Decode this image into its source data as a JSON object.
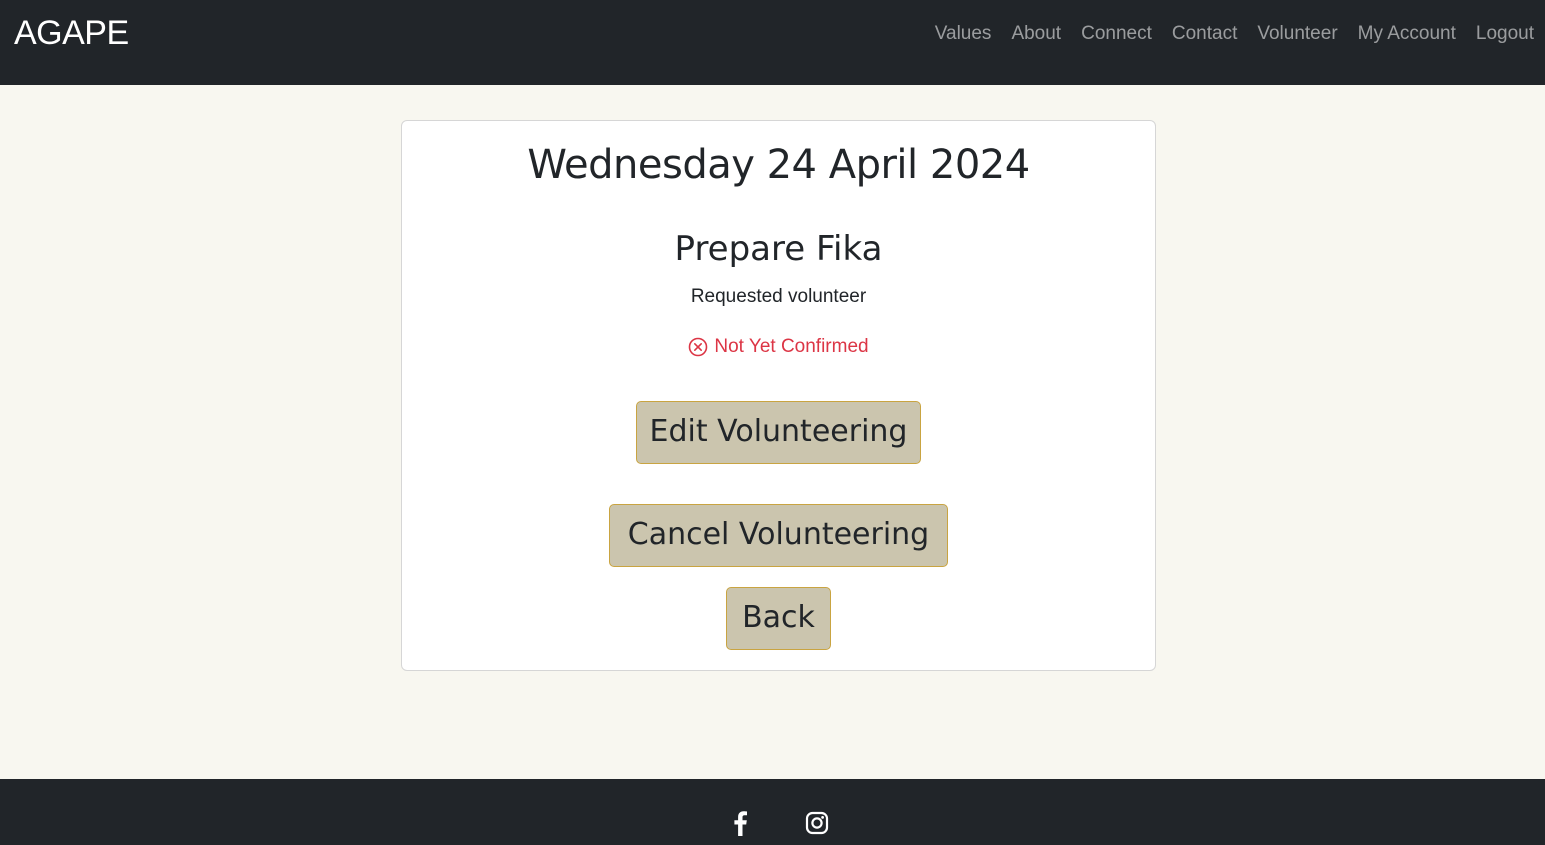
{
  "navbar": {
    "brand": "AGAPE",
    "links": [
      "Values",
      "About",
      "Connect",
      "Contact",
      "Volunteer",
      "My Account",
      "Logout"
    ]
  },
  "card": {
    "date": "Wednesday 24 April 2024",
    "title": "Prepare Fika",
    "subtitle": "Requested volunteer",
    "status": {
      "icon": "x-circle-icon",
      "text": "Not Yet Confirmed",
      "color": "#dc3545"
    },
    "buttons": {
      "edit": "Edit Volunteering",
      "cancel": "Cancel Volunteering",
      "back": "Back"
    }
  },
  "footer": {
    "social": [
      "facebook-icon",
      "instagram-icon"
    ]
  },
  "colors": {
    "navbar_bg": "#212529",
    "page_bg": "#f8f7f0",
    "button_bg": "#cbc5ae",
    "button_border": "#c9a441"
  }
}
